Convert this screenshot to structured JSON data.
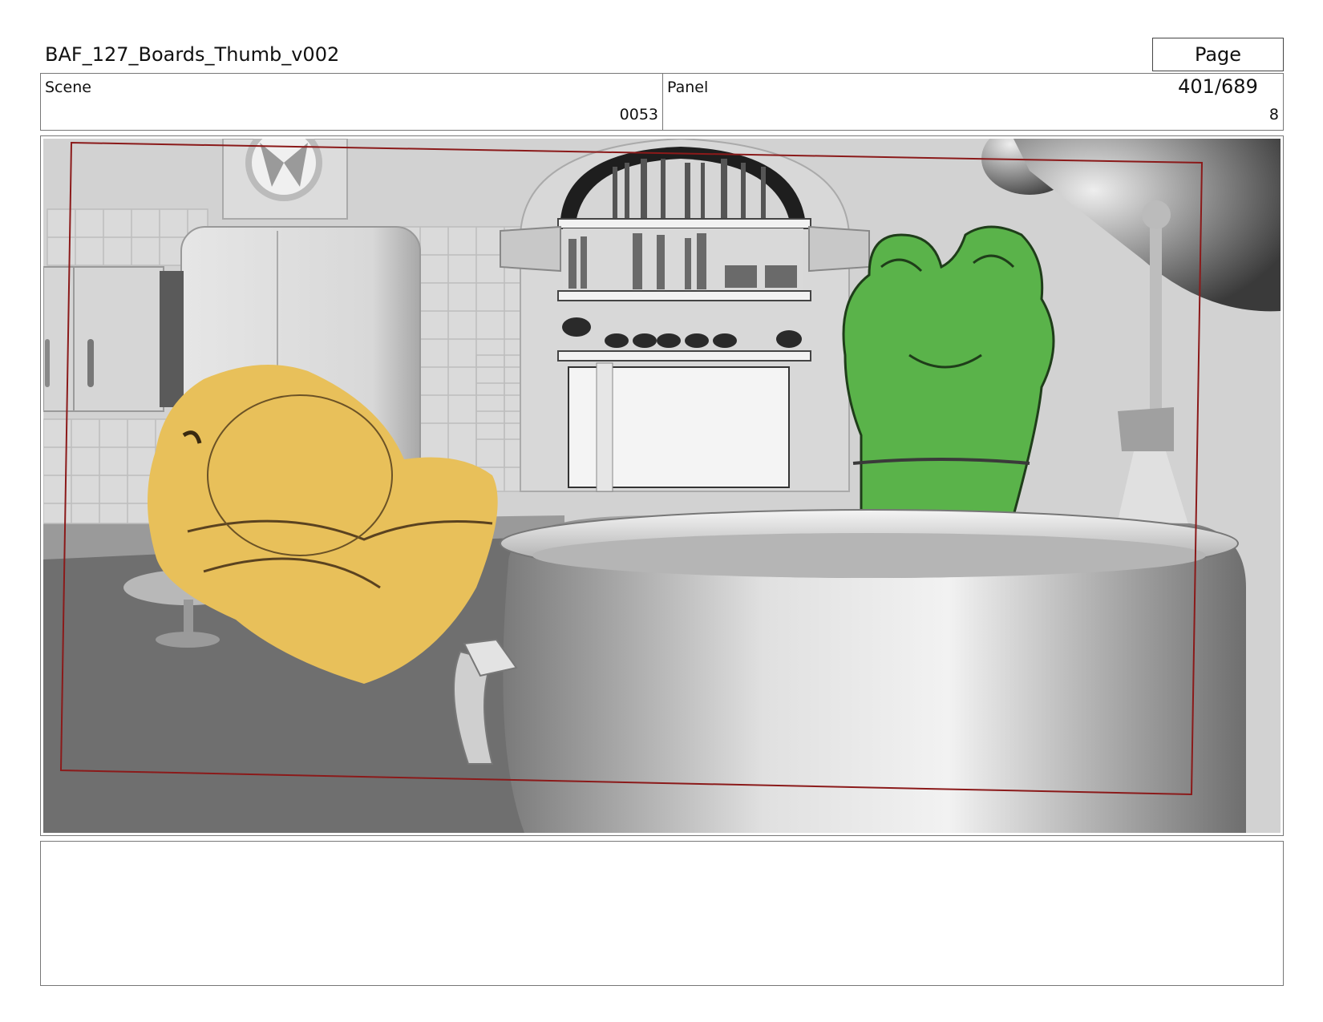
{
  "header": {
    "title": "BAF_127_Boards_Thumb_v002",
    "page": "Page 401/689"
  },
  "info": {
    "scene_label": "Scene",
    "scene_value": "0053",
    "panel_label": "Panel",
    "panel_value": "8"
  },
  "colors": {
    "safe_frame": "#8b1a1a",
    "yellow_character": "#e8c05a",
    "green_character": "#5ab34a",
    "set_gray": "#d4d4d4"
  },
  "notes": {
    "text": ""
  }
}
